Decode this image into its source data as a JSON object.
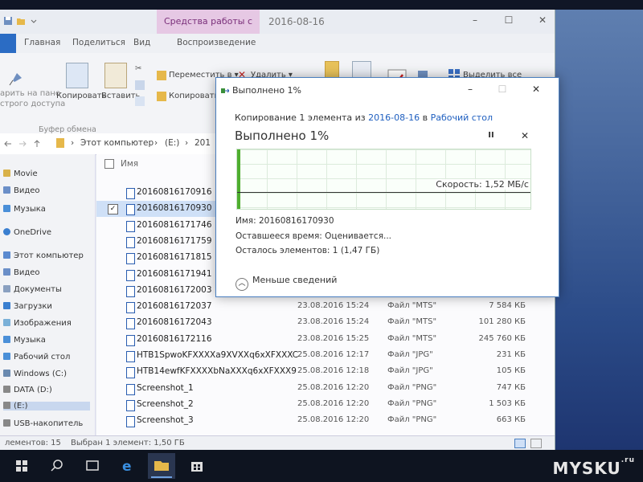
{
  "explorer": {
    "context_group": "Средства работы с видео",
    "window_title": "2016-08-16",
    "tabs": [
      "Главная",
      "Поделиться",
      "Вид",
      "Воспроизведение"
    ],
    "ribbon": {
      "pin_label_fragment": "арить на пане\nстрого доступа",
      "copy_label": "Копировать",
      "paste_label": "Вставить",
      "move_to": "Переместить в ▾",
      "delete": "Удалить ▾",
      "copy_to": "Копировать",
      "select_all": "Выделить все",
      "clipboard_group": "Буфер обмена"
    },
    "address": {
      "this_pc": "Этот компьютер",
      "sep": "›",
      "drive": "(E:)",
      "folder_fragment": "201"
    },
    "nav": [
      {
        "label": "Movie",
        "color": "#d9b24a"
      },
      {
        "label": "Видео",
        "color": "#6b8fc8"
      },
      {
        "label": "Музыка",
        "color": "#4a8fd8"
      },
      {
        "label": "OneDrive",
        "color": "#3a7fd0"
      },
      {
        "label": "Этот компьютер",
        "color": "#5b8ad0"
      },
      {
        "label": "Видео",
        "color": "#6b8fc8"
      },
      {
        "label": "Документы",
        "color": "#8aa0c0"
      },
      {
        "label": "Загрузки",
        "color": "#3a7fd0"
      },
      {
        "label": "Изображения",
        "color": "#7ab0d8"
      },
      {
        "label": "Музыка",
        "color": "#4a8fd8"
      },
      {
        "label": "Рабочий стол",
        "color": "#4a8fd8"
      },
      {
        "label": "Windows (C:)",
        "color": "#6a8ab0"
      },
      {
        "label": "DATA (D:)",
        "color": "#888"
      },
      {
        "label": "(E:)",
        "color": "#888"
      },
      {
        "label": "USB-накопитель",
        "color": "#888"
      }
    ],
    "list_header": "Имя",
    "files": [
      {
        "name": "20160816170916",
        "date": "",
        "type": "",
        "size": ""
      },
      {
        "name": "20160816170930",
        "date": "",
        "type": "",
        "size": "",
        "selected": true
      },
      {
        "name": "20160816171746",
        "date": "",
        "type": "",
        "size": ""
      },
      {
        "name": "20160816171759",
        "date": "",
        "type": "",
        "size": ""
      },
      {
        "name": "20160816171815",
        "date": "",
        "type": "",
        "size": ""
      },
      {
        "name": "20160816171941",
        "date": "",
        "type": "",
        "size": ""
      },
      {
        "name": "20160816172003",
        "date": "",
        "type": "",
        "size": ""
      },
      {
        "name": "20160816172037",
        "date": "23.08.2016 15:24",
        "type": "Файл \"MTS\"",
        "size": "7 584 КБ"
      },
      {
        "name": "20160816172043",
        "date": "23.08.2016 15:24",
        "type": "Файл \"MTS\"",
        "size": "101 280 КБ"
      },
      {
        "name": "20160816172116",
        "date": "23.08.2016 15:25",
        "type": "Файл \"MTS\"",
        "size": "245 760 КБ"
      },
      {
        "name": "HTB1SpwoKFXXXXa9XVXXq6xXFXXXC",
        "date": "25.08.2016 12:17",
        "type": "Файл \"JPG\"",
        "size": "231 КБ"
      },
      {
        "name": "HTB14ewfKFXXXXbNaXXXq6xXFXXX9",
        "date": "25.08.2016 12:18",
        "type": "Файл \"JPG\"",
        "size": "105 КБ"
      },
      {
        "name": "Screenshot_1",
        "date": "25.08.2016 12:20",
        "type": "Файл \"PNG\"",
        "size": "747 КБ"
      },
      {
        "name": "Screenshot_2",
        "date": "25.08.2016 12:20",
        "type": "Файл \"PNG\"",
        "size": "1 503 КБ"
      },
      {
        "name": "Screenshot_3",
        "date": "25.08.2016 12:20",
        "type": "Файл \"PNG\"",
        "size": "663 КБ"
      }
    ],
    "status": {
      "count": "лементов: 15",
      "selected": "Выбран 1 элемент: 1,50 ГБ"
    }
  },
  "dialog": {
    "title": "Выполнено 1%",
    "line_prefix": "Копирование 1 элемента из ",
    "source": "2016-08-16",
    "mid": " в ",
    "dest": "Рабочий стол",
    "big": "Выполнено 1%",
    "progress_fraction": 0.01,
    "speed": "Скорость: 1,52 МБ/с",
    "name_line": "Имя: 20160816170930",
    "time_line": "Оставшееся время: Оценивается...",
    "items_line": "Осталось элементов: 1 (1,47 ГБ)",
    "fewer_details": "Меньше сведений",
    "pause_glyph": "II",
    "close_glyph": "✕"
  },
  "watermark": {
    "text": "MYSKU",
    "sup": ".ru"
  },
  "colors": {
    "accent": "#2b6cc4",
    "progress": "#4fae2f",
    "link": "#2060c0"
  }
}
